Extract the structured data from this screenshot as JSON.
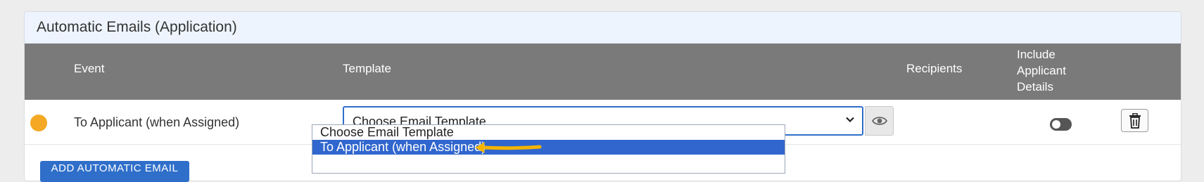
{
  "card": {
    "title": "Automatic Emails (Application)"
  },
  "table": {
    "headers": {
      "event": "Event",
      "template": "Template",
      "recipients": "Recipients",
      "include_applicant_details": [
        "Include",
        "Applicant",
        "Details"
      ]
    },
    "rows": [
      {
        "status_color": "#f4a823",
        "event": "To Applicant (when Assigned)",
        "template_select": "Choose Email Template",
        "include_applicant_details": false
      }
    ]
  },
  "dropdown": {
    "options": [
      "Choose Email Template",
      "To Applicant (when Assigned)"
    ],
    "highlighted": "To Applicant (when Assigned)"
  },
  "add_button": {
    "label": "ADD AUTOMATIC EMAIL"
  },
  "icons": {
    "preview": "eye-icon",
    "delete": "trash-icon",
    "select": "chevron-down-icon",
    "annotation": "arrow-left-icon"
  },
  "colors": {
    "header_bg": "#7a7a7a",
    "accent": "#2f6fca",
    "highlight": "#3066ce",
    "arrow": "#f4b400"
  }
}
